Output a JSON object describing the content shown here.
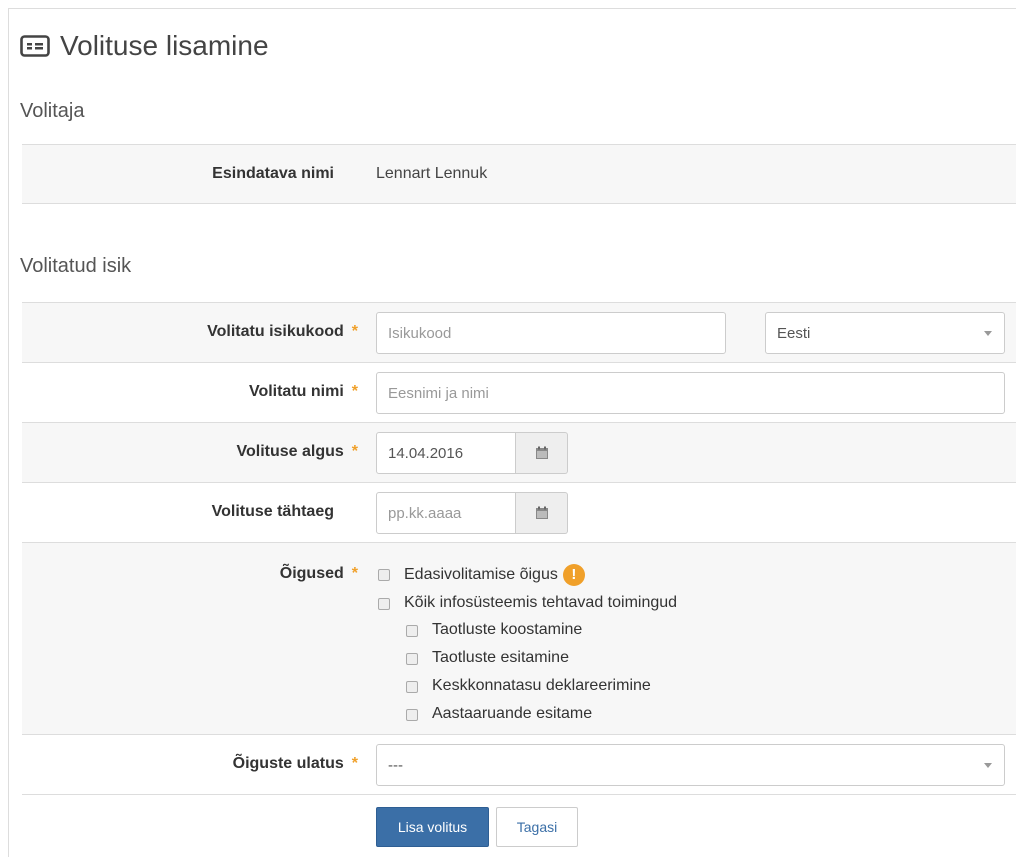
{
  "page": {
    "title": "Volituse lisamine",
    "title_icon": "id-card-icon"
  },
  "volitaja": {
    "heading": "Volitaja",
    "esindatava_label": "Esindatava nimi",
    "esindatava_value": "Lennart Lennuk"
  },
  "volitatud": {
    "heading": "Volitatud isik",
    "isikukood_label": "Volitatu isikukood",
    "isikukood_placeholder": "Isikukood",
    "country_value": "Eesti",
    "nimi_label": "Volitatu nimi",
    "nimi_placeholder": "Eesnimi ja nimi",
    "algus_label": "Volituse algus",
    "algus_value": "14.04.2016",
    "tahtaeg_label": "Volituse tähtaeg",
    "tahtaeg_placeholder": "pp.kk.aaaa",
    "oigused_label": "Õigused",
    "oigused": [
      "Edasivolitamise õigus",
      "Kõik infosüsteemis tehtavad toimingud",
      "Taotluste koostamine",
      "Taotluste esitamine",
      "Keskkonnatasu deklareerimine",
      "Aastaaruande esitame"
    ],
    "ulatus_label": "Õiguste ulatus",
    "ulatus_value": "---"
  },
  "required_mark": "*",
  "warning_symbol": "!",
  "buttons": {
    "submit": "Lisa volitus",
    "back": "Tagasi"
  },
  "colors": {
    "primary": "#3b6fa7",
    "required": "#f0a02a",
    "warning": "#f0a02a"
  }
}
